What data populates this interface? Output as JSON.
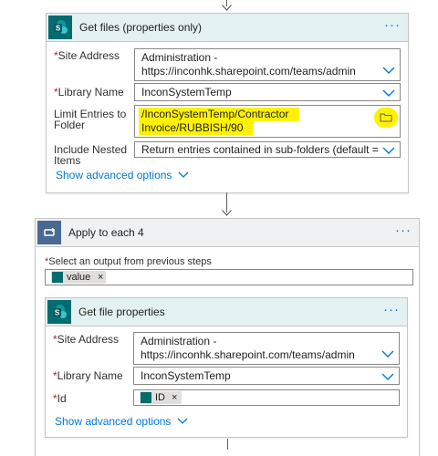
{
  "get_files": {
    "title": "Get files (properties only)",
    "menu": "···",
    "site_address_label": "Site Address",
    "site_address_line1": "Administration -",
    "site_address_line2": "https://inconhk.sharepoint.com/teams/admin",
    "library_label": "Library Name",
    "library_value": "InconSystemTemp",
    "limit_label_line1": "Limit Entries to",
    "limit_label_line2": "Folder",
    "limit_value_line1": "/InconSystemTemp/Contractor",
    "limit_value_line2": "Invoice/RUBBISH/90",
    "nested_label_line1": "Include Nested",
    "nested_label_line2": "Items",
    "nested_value": "Return entries contained in sub-folders (default =",
    "advanced": "Show advanced options"
  },
  "apply_each": {
    "title": "Apply to each 4",
    "menu": "···",
    "output_label": "Select an output from previous steps",
    "token": "value"
  },
  "get_file_props": {
    "title": "Get file properties",
    "menu": "···",
    "site_address_label": "Site Address",
    "site_address_line1": "Administration -",
    "site_address_line2": "https://inconhk.sharepoint.com/teams/admin",
    "library_label": "Library Name",
    "library_value": "InconSystemTemp",
    "id_label": "Id",
    "id_token": "ID",
    "advanced": "Show advanced options"
  },
  "required_mark": "*",
  "token_remove": "×",
  "colors": {
    "accent": "#0078d4",
    "sharepoint": "#036c70",
    "highlight": "#fff200",
    "loop_header": "#eff1f3",
    "loop_icon": "#486991"
  }
}
